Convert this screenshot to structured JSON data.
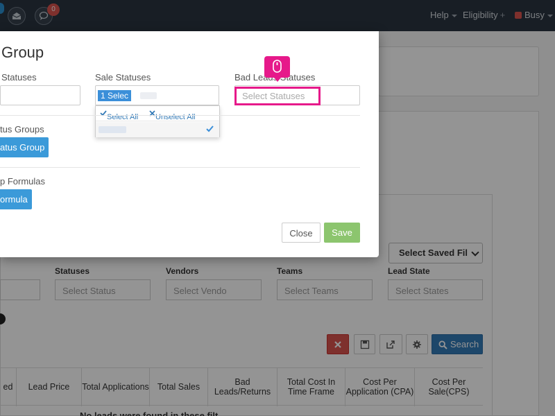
{
  "topbar": {
    "notification_count": "0",
    "help_label": "Help",
    "eligibility_label": "Eligibility",
    "busy_label": "Busy",
    "status_color": "#d9534f"
  },
  "background": {
    "saved_filter_label": "Select Saved Fil",
    "filters": [
      {
        "label": "Statuses",
        "placeholder": "Select Status"
      },
      {
        "label": "Vendors",
        "placeholder": "Select Vendo"
      },
      {
        "label": "Teams",
        "placeholder": "Select Teams"
      },
      {
        "label": "Lead State",
        "placeholder": "Select States"
      }
    ],
    "search_label": "Search",
    "table_headers": [
      "ed",
      "Lead Price",
      "Total Applications",
      "Total Sales",
      "Bad Leads/Returns",
      "Total Cost In Time Frame",
      "Cost Per Application (CPA)",
      "Cost Per Sale(CPS)"
    ],
    "no_records_text": "No leads were found in these filt"
  },
  "modal": {
    "title": "Group",
    "statuses_label": "Statuses",
    "sale_statuses_label": "Sale Statuses",
    "sale_statuses_chip": "1 Selec",
    "bad_leads_label": "Bad Leads Statuses",
    "bad_leads_placeholder": "Select Statuses",
    "dropdown": {
      "select_all": "Select All",
      "unselect_all": "Unselect All"
    },
    "status_groups_label": "tus Groups",
    "status_group_button": "atus Group",
    "formulas_label": "p Formulas",
    "formula_button": "ormula",
    "close_label": "Close",
    "save_label": "Save"
  },
  "colors": {
    "accent": "#3b9ad9",
    "highlight": "#e6198a",
    "save": "#8cc56e",
    "danger": "#d9534f"
  }
}
